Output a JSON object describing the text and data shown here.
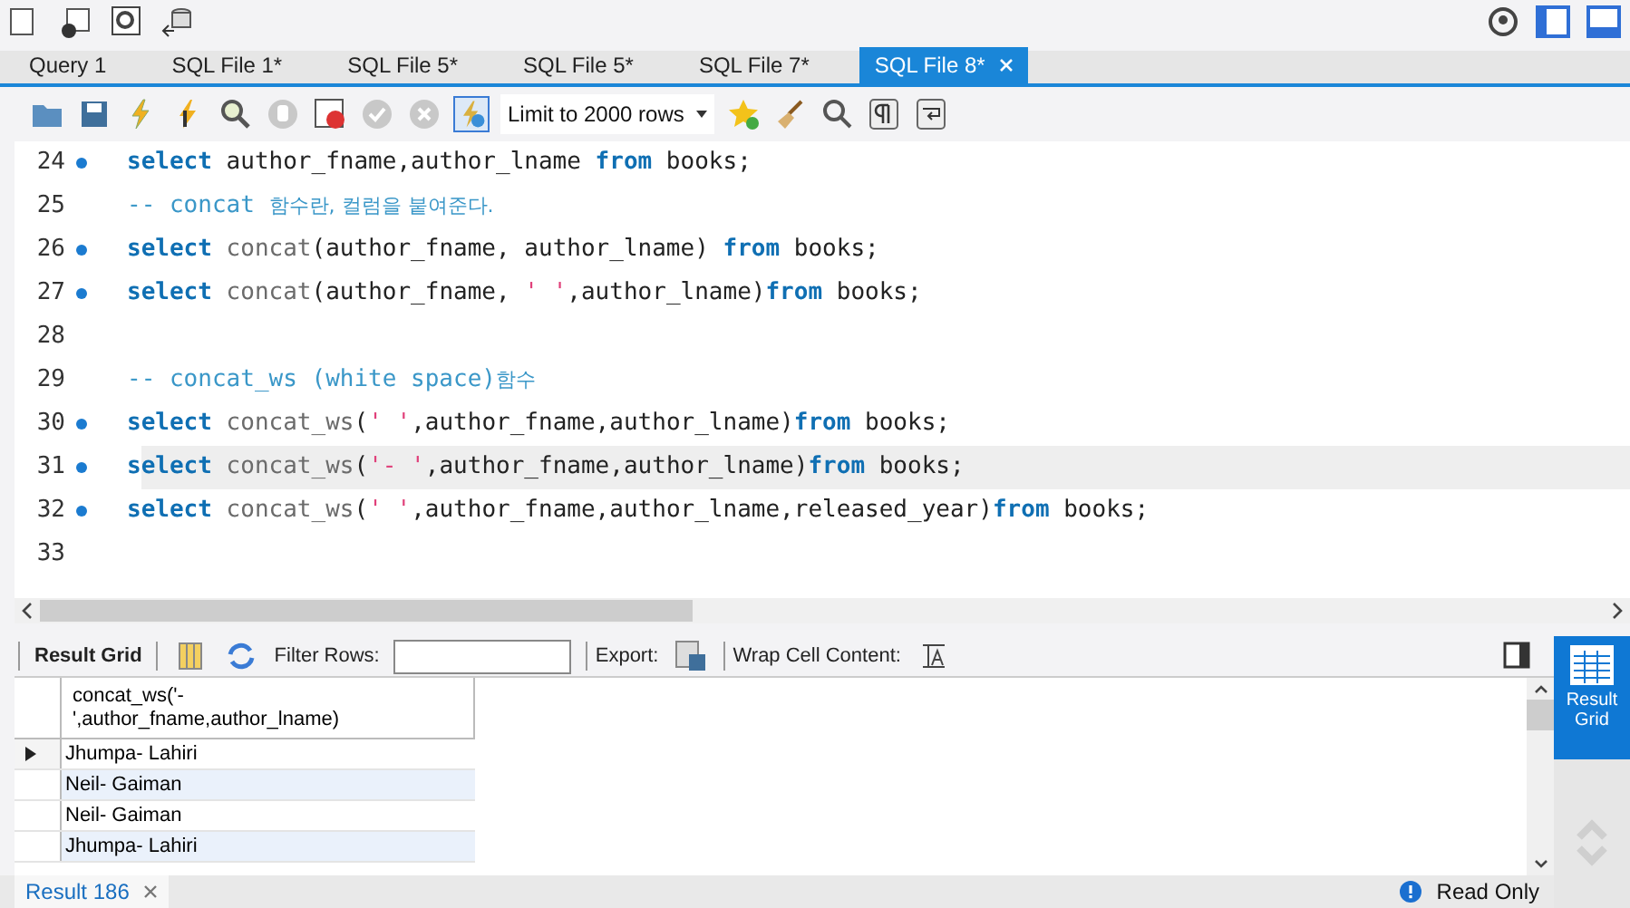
{
  "tabs": [
    {
      "label": "Query 1",
      "selected": false,
      "closable": false
    },
    {
      "label": "SQL File 1*",
      "selected": false,
      "closable": false
    },
    {
      "label": "SQL File 5*",
      "selected": false,
      "closable": false
    },
    {
      "label": "SQL File 5*",
      "selected": false,
      "closable": false
    },
    {
      "label": "SQL File 7*",
      "selected": false,
      "closable": false
    },
    {
      "label": "SQL File 8*",
      "selected": true,
      "closable": true
    }
  ],
  "limit_select": {
    "value": "Limit to 2000 rows"
  },
  "editor": {
    "lines": [
      {
        "number": "24",
        "marker": true,
        "current": false,
        "tokens": [
          {
            "kind": "kw",
            "text": "select"
          },
          {
            "kind": "plain",
            "text": " author_fname,author_lname "
          },
          {
            "kind": "kw",
            "text": "from"
          },
          {
            "kind": "plain",
            "text": " books;"
          }
        ]
      },
      {
        "number": "25",
        "marker": false,
        "current": false,
        "tokens": [
          {
            "kind": "cmt",
            "text": "-- concat "
          },
          {
            "kind": "cmtko",
            "text": "함수란, 컬럼을 붙여준다."
          }
        ]
      },
      {
        "number": "26",
        "marker": true,
        "current": false,
        "tokens": [
          {
            "kind": "kw",
            "text": "select"
          },
          {
            "kind": "fn",
            "text": " concat"
          },
          {
            "kind": "plain",
            "text": "(author_fname, author_lname) "
          },
          {
            "kind": "kw",
            "text": "from"
          },
          {
            "kind": "plain",
            "text": " books;"
          }
        ]
      },
      {
        "number": "27",
        "marker": true,
        "current": false,
        "tokens": [
          {
            "kind": "kw",
            "text": "select"
          },
          {
            "kind": "fn",
            "text": " concat"
          },
          {
            "kind": "plain",
            "text": "(author_fname, "
          },
          {
            "kind": "str",
            "text": "' '"
          },
          {
            "kind": "plain",
            "text": ",author_lname)"
          },
          {
            "kind": "kw",
            "text": "from"
          },
          {
            "kind": "plain",
            "text": " books;"
          }
        ]
      },
      {
        "number": "28",
        "marker": false,
        "current": false
      },
      {
        "number": "29",
        "marker": false,
        "current": false,
        "tokens": [
          {
            "kind": "cmt",
            "text": "-- concat_ws (white space)"
          },
          {
            "kind": "cmtko",
            "text": "함수"
          }
        ]
      },
      {
        "number": "30",
        "marker": true,
        "current": false,
        "tokens": [
          {
            "kind": "kw",
            "text": "select"
          },
          {
            "kind": "fn",
            "text": " concat_ws"
          },
          {
            "kind": "plain",
            "text": "("
          },
          {
            "kind": "str",
            "text": "' '"
          },
          {
            "kind": "plain",
            "text": ",author_fname,author_lname)"
          },
          {
            "kind": "kw",
            "text": "from"
          },
          {
            "kind": "plain",
            "text": " books;"
          }
        ]
      },
      {
        "number": "31",
        "marker": true,
        "current": true,
        "tokens": [
          {
            "kind": "kw",
            "text": "select"
          },
          {
            "kind": "fn",
            "text": " concat_ws"
          },
          {
            "kind": "plain",
            "text": "("
          },
          {
            "kind": "str",
            "text": "'- '"
          },
          {
            "kind": "plain",
            "text": ",author_fname,author_lname)"
          },
          {
            "kind": "kw",
            "text": "from"
          },
          {
            "kind": "plain",
            "text": " books;"
          }
        ]
      },
      {
        "number": "32",
        "marker": true,
        "current": false,
        "tokens": [
          {
            "kind": "kw",
            "text": "select"
          },
          {
            "kind": "fn",
            "text": " concat_ws"
          },
          {
            "kind": "plain",
            "text": "("
          },
          {
            "kind": "str",
            "text": "' '"
          },
          {
            "kind": "plain",
            "text": ",author_fname,author_lname,released_year)"
          },
          {
            "kind": "kw",
            "text": "from"
          },
          {
            "kind": "plain",
            "text": " books;"
          }
        ]
      },
      {
        "number": "33",
        "marker": false,
        "current": false
      }
    ]
  },
  "result_toolbar": {
    "result_grid": "Result Grid",
    "filter_label": "Filter Rows:",
    "export_label": "Export:",
    "wrap_label": "Wrap Cell Content:"
  },
  "grid": {
    "column": "concat_ws('-\n',author_fname,author_lname)",
    "rows": [
      {
        "value": "Jhumpa- Lahiri",
        "selected": true
      },
      {
        "value": "Neil- Gaiman",
        "selected": false
      },
      {
        "value": "Neil- Gaiman",
        "selected": false
      },
      {
        "value": "Jhumpa- Lahiri",
        "selected": false
      }
    ]
  },
  "side_panel": {
    "label": "Result\nGrid"
  },
  "result_tab": {
    "label": "Result 186"
  },
  "status": {
    "text": "Read Only"
  }
}
